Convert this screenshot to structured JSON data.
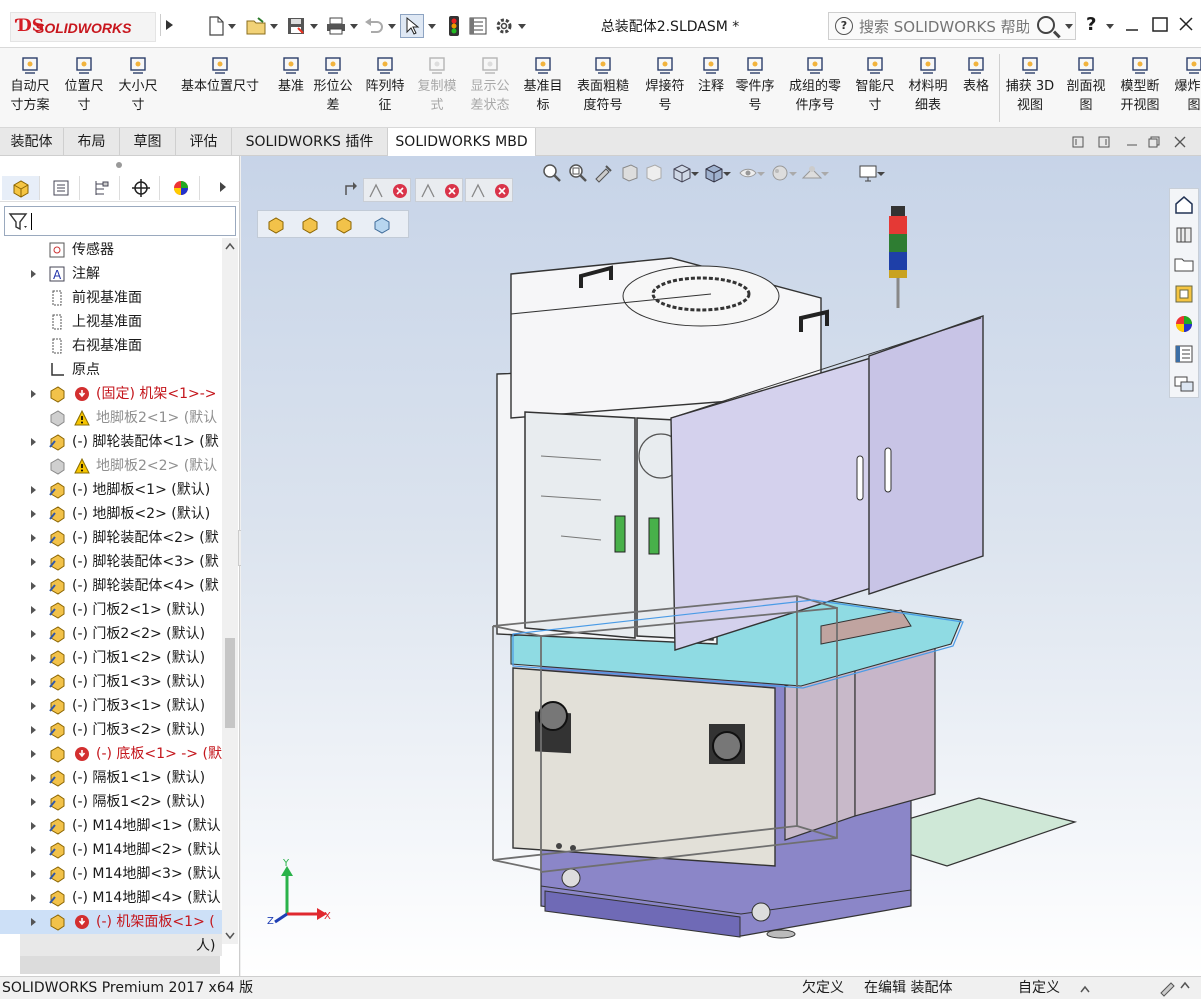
{
  "app": {
    "logo_text": "SOLIDWORKS",
    "document_title": "总装配体2.SLDASM *",
    "search_placeholder": "搜索 SOLIDWORKS 帮助",
    "help_label": "?"
  },
  "commands": [
    {
      "name": "auto-dimension-scheme",
      "label": "自动尺\n寸方案",
      "icon": "auto-dim-icon",
      "enabled": true
    },
    {
      "name": "location-dimension",
      "label": "位置尺\n寸",
      "icon": "location-dim-icon",
      "enabled": true
    },
    {
      "name": "size-dimension",
      "label": "大小尺\n寸",
      "icon": "size-dim-icon",
      "enabled": true
    },
    {
      "name": "basic-location-dimension",
      "label": "基本位置尺寸",
      "icon": "basic-loc-dim-icon",
      "enabled": true
    },
    {
      "name": "datum",
      "label": "基准",
      "icon": "datum-icon",
      "enabled": true
    },
    {
      "name": "geometric-tolerance",
      "label": "形位公\n差",
      "icon": "geo-tol-icon",
      "enabled": true
    },
    {
      "name": "pattern-feature",
      "label": "阵列特\n征",
      "icon": "pattern-icon",
      "enabled": true
    },
    {
      "name": "copy-scheme",
      "label": "复制模\n式",
      "icon": "copy-scheme-icon",
      "enabled": false
    },
    {
      "name": "show-tolerance-status",
      "label": "显示公\n差状态",
      "icon": "tol-status-icon",
      "enabled": false
    },
    {
      "name": "datum-target",
      "label": "基准目\n标",
      "icon": "datum-target-icon",
      "enabled": true
    },
    {
      "name": "surface-finish",
      "label": "表面粗糙\n度符号",
      "icon": "surface-finish-icon",
      "enabled": true
    },
    {
      "name": "weld-symbol",
      "label": "焊接符\n号",
      "icon": "weld-icon",
      "enabled": true
    },
    {
      "name": "note",
      "label": "注释",
      "icon": "note-icon",
      "enabled": true
    },
    {
      "name": "balloon",
      "label": "零件序\n号",
      "icon": "balloon-icon",
      "enabled": true
    },
    {
      "name": "stacked-balloon",
      "label": "成组的零\n件序号",
      "icon": "stacked-balloon-icon",
      "enabled": true
    },
    {
      "name": "smart-dimension",
      "label": "智能尺\n寸",
      "icon": "smart-dim-icon",
      "enabled": true
    },
    {
      "name": "bill-of-materials",
      "label": "材料明\n细表",
      "icon": "bom-icon",
      "enabled": true
    },
    {
      "name": "table",
      "label": "表格",
      "icon": "table-icon",
      "enabled": true
    },
    {
      "name": "capture-3d-view",
      "label": "捕获 3D\n视图",
      "icon": "capture-3d-icon",
      "enabled": true
    },
    {
      "name": "section-view",
      "label": "剖面视\n图",
      "icon": "section-view-icon",
      "enabled": true
    },
    {
      "name": "model-break-view",
      "label": "模型断\n开视图",
      "icon": "break-view-icon",
      "enabled": true
    },
    {
      "name": "exploded-view",
      "label": "爆炸视\n图",
      "icon": "exploded-view-icon",
      "enabled": true
    }
  ],
  "tabs": [
    {
      "label": "装配体",
      "active": false
    },
    {
      "label": "布局",
      "active": false
    },
    {
      "label": "草图",
      "active": false
    },
    {
      "label": "评估",
      "active": false
    },
    {
      "label": "SOLIDWORKS 插件",
      "active": false
    },
    {
      "label": "SOLIDWORKS MBD",
      "active": true
    }
  ],
  "tree": [
    {
      "label": "传感器",
      "kind": "sensor",
      "expand": false,
      "state": "normal"
    },
    {
      "label": "注解",
      "kind": "annotation",
      "expand": true,
      "state": "normal"
    },
    {
      "label": "前视基准面",
      "kind": "plane",
      "expand": false,
      "state": "normal"
    },
    {
      "label": "上视基准面",
      "kind": "plane",
      "expand": false,
      "state": "normal"
    },
    {
      "label": "右视基准面",
      "kind": "plane",
      "expand": false,
      "state": "normal"
    },
    {
      "label": "原点",
      "kind": "origin",
      "expand": false,
      "state": "normal"
    },
    {
      "label": "(固定) 机架<1>->",
      "kind": "part-error",
      "expand": true,
      "state": "red"
    },
    {
      "label": "地脚板2<1> (默认",
      "kind": "part-warning",
      "expand": false,
      "state": "grey"
    },
    {
      "label": "(-) 脚轮装配体<1> (默",
      "kind": "assembly",
      "expand": true,
      "state": "normal"
    },
    {
      "label": "地脚板2<2> (默认",
      "kind": "part-warning",
      "expand": false,
      "state": "grey"
    },
    {
      "label": "(-) 地脚板<1> (默认)",
      "kind": "part",
      "expand": true,
      "state": "normal"
    },
    {
      "label": "(-) 地脚板<2> (默认)",
      "kind": "part",
      "expand": true,
      "state": "normal"
    },
    {
      "label": "(-) 脚轮装配体<2> (默",
      "kind": "assembly",
      "expand": true,
      "state": "normal"
    },
    {
      "label": "(-) 脚轮装配体<3> (默",
      "kind": "assembly",
      "expand": true,
      "state": "normal"
    },
    {
      "label": "(-) 脚轮装配体<4> (默",
      "kind": "assembly",
      "expand": true,
      "state": "normal"
    },
    {
      "label": "(-) 门板2<1> (默认)",
      "kind": "part",
      "expand": true,
      "state": "normal"
    },
    {
      "label": "(-) 门板2<2> (默认)",
      "kind": "part",
      "expand": true,
      "state": "normal"
    },
    {
      "label": "(-) 门板1<2> (默认)",
      "kind": "part",
      "expand": true,
      "state": "normal"
    },
    {
      "label": "(-) 门板1<3> (默认)",
      "kind": "part",
      "expand": true,
      "state": "normal"
    },
    {
      "label": "(-) 门板3<1> (默认)",
      "kind": "part",
      "expand": true,
      "state": "normal"
    },
    {
      "label": "(-) 门板3<2> (默认)",
      "kind": "part",
      "expand": true,
      "state": "normal"
    },
    {
      "label": "(-) 底板<1> -> (默",
      "kind": "part-error",
      "expand": true,
      "state": "red"
    },
    {
      "label": "(-) 隔板1<1> (默认)",
      "kind": "part",
      "expand": true,
      "state": "normal"
    },
    {
      "label": "(-) 隔板1<2> (默认)",
      "kind": "part",
      "expand": true,
      "state": "normal"
    },
    {
      "label": "(-) M14地脚<1> (默认",
      "kind": "part",
      "expand": true,
      "state": "normal"
    },
    {
      "label": "(-) M14地脚<2> (默认",
      "kind": "part",
      "expand": true,
      "state": "normal"
    },
    {
      "label": "(-) M14地脚<3> (默认",
      "kind": "part",
      "expand": true,
      "state": "normal"
    },
    {
      "label": "(-) M14地脚<4> (默认",
      "kind": "part",
      "expand": true,
      "state": "normal"
    },
    {
      "label": "(-) 机架面板<1> (",
      "kind": "part-error",
      "expand": true,
      "state": "red-selected"
    }
  ],
  "tree_truncated_text": "人)",
  "triad": {
    "x": "X",
    "y": "Y",
    "z": "Z"
  },
  "status": {
    "product": "SOLIDWORKS Premium 2017 x64 版",
    "underdefined": "欠定义",
    "editing": "在编辑 装配体",
    "units": "自定义"
  },
  "colors": {
    "brand_red": "#d41c24",
    "tree_error_red": "#c4161c",
    "selection_blue": "#cde0f7",
    "viewport_top": "#c7d4e8"
  }
}
